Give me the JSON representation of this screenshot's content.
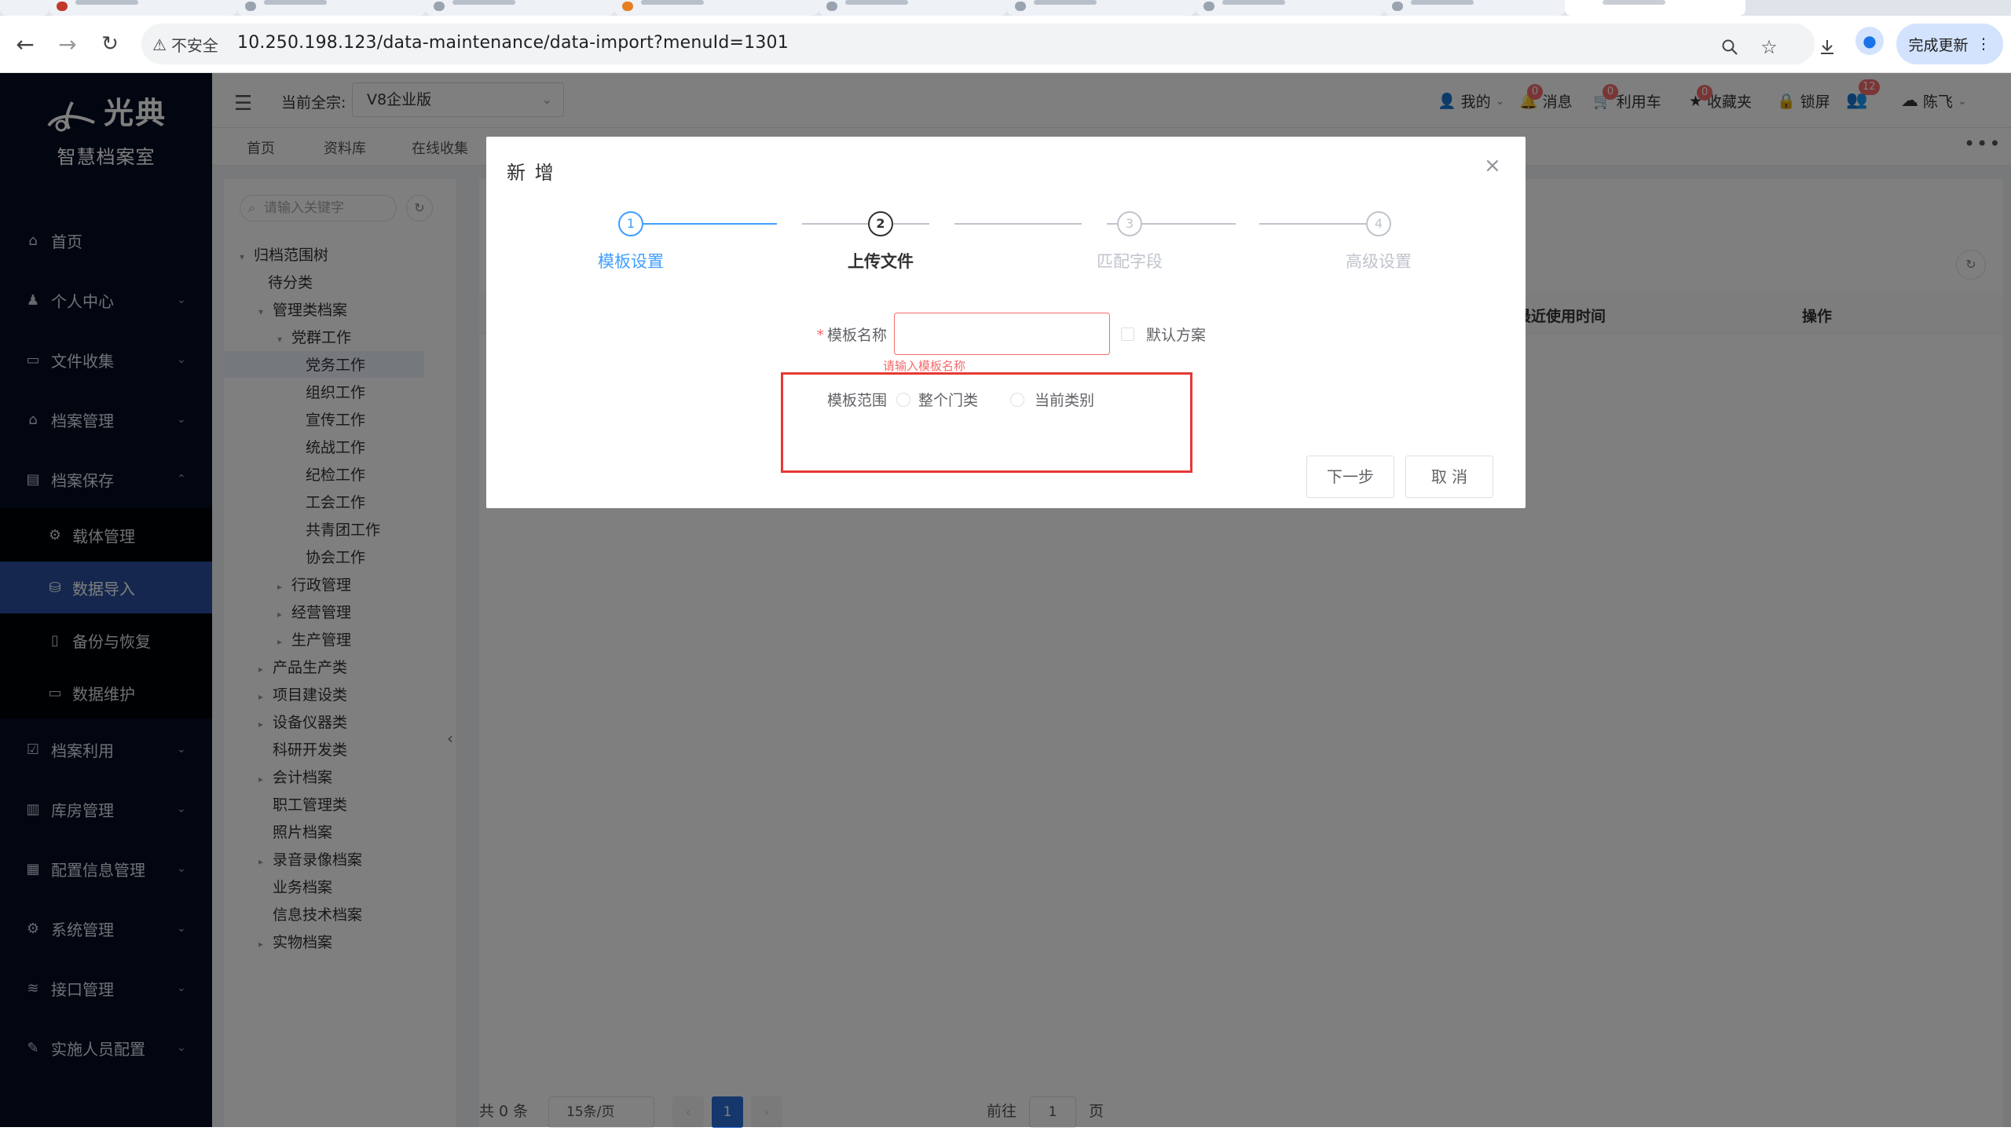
{
  "browser": {
    "insecure_label": "不安全",
    "url": "10.250.198.123/data-maintenance/data-import?menuId=1301",
    "update_label": "完成更新"
  },
  "sidebar": {
    "brand": "光典",
    "subtitle": "智慧档案室",
    "items": [
      {
        "label": "首页",
        "icon": "home-icon"
      },
      {
        "label": "个人中心",
        "icon": "user-icon"
      },
      {
        "label": "文件收集",
        "icon": "briefcase-icon"
      },
      {
        "label": "档案管理",
        "icon": "bank-icon"
      },
      {
        "label": "档案保存",
        "icon": "archive-icon"
      },
      {
        "label": "载体管理",
        "icon": "chip-icon"
      },
      {
        "label": "数据导入",
        "icon": "database-icon"
      },
      {
        "label": "备份与恢复",
        "icon": "document-icon"
      },
      {
        "label": "数据维护",
        "icon": "folder-icon"
      },
      {
        "label": "档案利用",
        "icon": "clipboard-check-icon"
      },
      {
        "label": "库房管理",
        "icon": "building-icon"
      },
      {
        "label": "配置信息管理",
        "icon": "clipboard-icon"
      },
      {
        "label": "系统管理",
        "icon": "gear-icon"
      },
      {
        "label": "接口管理",
        "icon": "stack-icon"
      },
      {
        "label": "实施人员配置",
        "icon": "wrench-icon"
      }
    ]
  },
  "topbar": {
    "quanzong_label": "当前全宗:",
    "quanzong_value": "V8企业版",
    "mine": "我的",
    "messages": "消息",
    "messages_badge": "0",
    "cart": "利用车",
    "cart_badge": "0",
    "favorites": "收藏夹",
    "favorites_badge": "0",
    "lock": "锁屏",
    "users_badge": "12",
    "username": "陈飞"
  },
  "tags": [
    "首页",
    "资料库",
    "在线收集"
  ],
  "tree": {
    "search_placeholder": "请输入关键字",
    "nodes": [
      "归档范围树",
      "待分类",
      "管理类档案",
      "党群工作",
      "党务工作",
      "组织工作",
      "宣传工作",
      "统战工作",
      "纪检工作",
      "工会工作",
      "共青团工作",
      "协会工作",
      "行政管理",
      "经营管理",
      "生产管理",
      "产品生产类",
      "项目建设类",
      "设备仪器类",
      "科研开发类",
      "会计档案",
      "职工管理类",
      "照片档案",
      "录音录像档案",
      "业务档案",
      "信息技术档案",
      "实物档案"
    ]
  },
  "table": {
    "columns": [
      "最近使用时间",
      "操作"
    ]
  },
  "pager": {
    "total": "共 0 条",
    "page_size": "15条/页",
    "current": "1",
    "goto_prefix": "前往",
    "goto_value": "1",
    "goto_suffix": "页"
  },
  "modal": {
    "title": "新 增",
    "steps": [
      "模板设置",
      "上传文件",
      "匹配字段",
      "高级设置"
    ],
    "step_numbers": [
      "1",
      "2",
      "3",
      "4"
    ],
    "name_label": "模板名称",
    "name_value": "",
    "name_error": "请输入模板名称",
    "default_checkbox": "默认方案",
    "scope_label": "模板范围",
    "scope_options": [
      "整个门类",
      "当前类别"
    ],
    "next_button": "下一步",
    "cancel_button": "取 消"
  },
  "colors": {
    "sidebar_bg": "#040c22",
    "active_menu": "#2a4f9e",
    "step_done": "#409eff",
    "error": "#f56c6c",
    "highlight_box": "#e53935"
  }
}
